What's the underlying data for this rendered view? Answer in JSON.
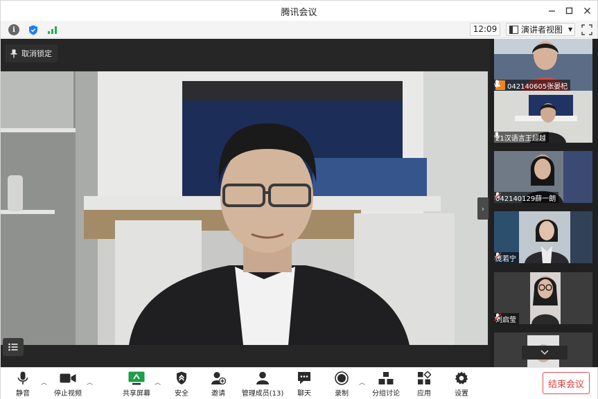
{
  "window": {
    "title": "腾讯会议"
  },
  "status": {
    "clock": "12:09",
    "view_label": "演讲者视图"
  },
  "stage": {
    "unpin_label": "取消锁定"
  },
  "participants": [
    {
      "name": "042140605张晏杞",
      "badge": "orange",
      "mic": "on"
    },
    {
      "name": "21汉语言王超越",
      "badge": "none",
      "mic": "on"
    },
    {
      "name": "042140129薛一朗",
      "badge": "none",
      "mic": "muted"
    },
    {
      "name": "庞若宁",
      "badge": "none",
      "mic": "muted"
    },
    {
      "name": "刘启莹",
      "badge": "none",
      "mic": "muted"
    }
  ],
  "toolbar": {
    "mute_label": "静音",
    "stop_video_label": "停止视频",
    "share_label": "共享屏幕",
    "security_label": "安全",
    "invite_label": "邀请",
    "members_label": "管理成员(13)",
    "chat_label": "聊天",
    "record_label": "录制",
    "breakout_label": "分组讨论",
    "apps_label": "应用",
    "settings_label": "设置",
    "end_label": "结束会议"
  },
  "colors": {
    "accent": "#1f7ff0",
    "end": "#e03b3b",
    "badge": "#f0861e",
    "signal": "#22b14c"
  }
}
